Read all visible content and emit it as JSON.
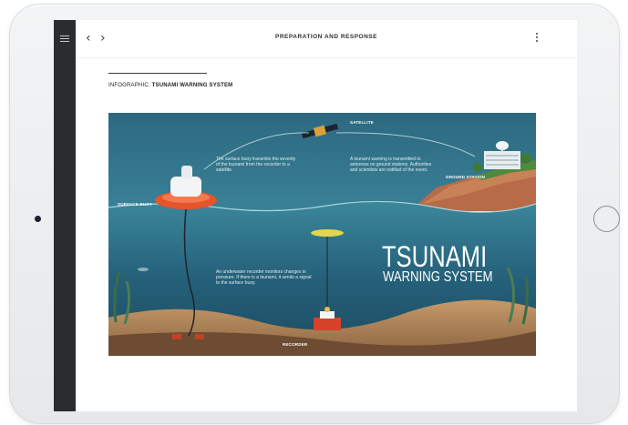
{
  "toolbar": {
    "title": "PREPARATION AND RESPONSE",
    "back_icon": "chevron-left-icon",
    "forward_icon": "chevron-right-icon",
    "menu_icon": "hamburger-menu-icon",
    "more_icon": "vertical-ellipsis-icon"
  },
  "article": {
    "heading_prefix": "INFOGRAPHIC:",
    "heading_title": "TSUNAMI WARNING SYSTEM"
  },
  "infographic": {
    "title_line1": "TSUNAMI",
    "title_line2": "WARNING SYSTEM",
    "labels": {
      "satellite": "SATELLITE",
      "ground_station": "GROUND STATION",
      "surface_buoy": "SURFACE BUOY",
      "recorder": "RECORDER"
    },
    "captions": {
      "buoy_to_satellite": "The surface buoy transmits the severity of the tsunami from the recorder to a satellite.",
      "satellite_to_ground": "A tsunami warning is transmitted to antennas on ground stations. Authorities and scientists are notified of the event.",
      "recorder_to_buoy": "An underwater recorder monitors changes in pressure. If there is a tsunami, it sends a signal to the surface buoy."
    },
    "colors": {
      "sky": "#2e6f86",
      "water": "#2a6a80",
      "deep_water": "#1f4f62",
      "seabed": "#b58a5e",
      "buoy": "#e5542b"
    }
  }
}
